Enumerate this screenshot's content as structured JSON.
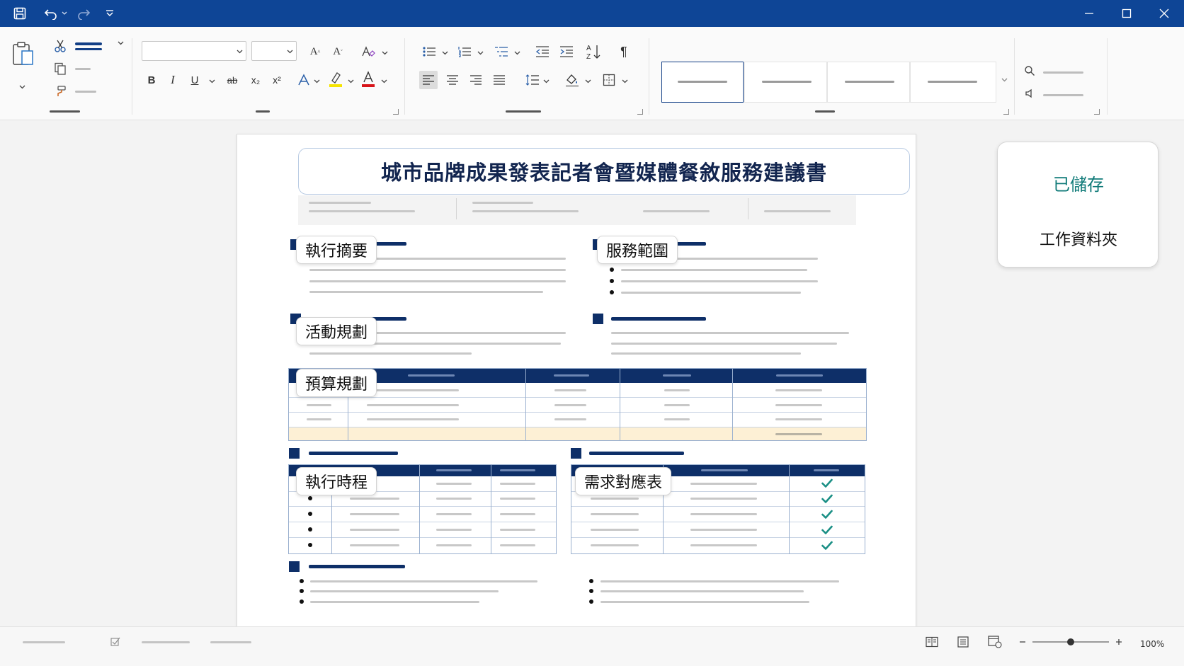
{
  "colors": {
    "titlebar": "#0e4596",
    "accent_navy": "#0e2f68",
    "saved_teal": "#0f7a78",
    "highlight_row": "#fdf0d5",
    "check_green": "#1a8f85"
  },
  "titlebar": {
    "icons": [
      "save-icon",
      "undo-icon",
      "redo-icon",
      "customize-qat-icon"
    ],
    "window_controls": [
      "minimize-icon",
      "maximize-icon",
      "close-icon"
    ]
  },
  "ribbon": {
    "font_buttons": {
      "bold": "B",
      "italic": "I",
      "underline": "U",
      "strike": "ab",
      "subscript": "x₂",
      "superscript": "x²"
    },
    "grow_font": "A",
    "shrink_font": "A",
    "paragraph_mark": "¶",
    "sort": "A↓",
    "icons": [
      "paste-icon",
      "cut-icon",
      "copy-icon",
      "format-painter-icon",
      "clear-format-icon",
      "text-effects-icon",
      "highlight-icon",
      "font-color-icon",
      "bullets-icon",
      "numbering-icon",
      "multilevel-icon",
      "decrease-indent-icon",
      "increase-indent-icon",
      "sort-icon",
      "show-marks-icon",
      "align-left-icon",
      "center-icon",
      "align-right-icon",
      "justify-icon",
      "line-spacing-icon",
      "shading-icon",
      "borders-icon",
      "find-icon",
      "dictate-icon"
    ]
  },
  "document": {
    "title": "城市品牌成果發表記者會暨媒體餐敘服務建議書",
    "sections": [
      {
        "label": "執行摘要"
      },
      {
        "label": "服務範圍"
      },
      {
        "label": "活動規劃"
      },
      {
        "label": "預算規劃"
      },
      {
        "label": "執行時程"
      },
      {
        "label": "需求對應表"
      }
    ],
    "requirements_checks": 5
  },
  "side_panel": {
    "saved": "已儲存",
    "folder": "工作資料夾"
  },
  "statusbar": {
    "zoom": "100%",
    "zoom_level": 1.0,
    "icons": [
      "read-mode-icon",
      "print-layout-icon",
      "web-layout-icon",
      "zoom-out-icon",
      "zoom-in-icon"
    ]
  }
}
